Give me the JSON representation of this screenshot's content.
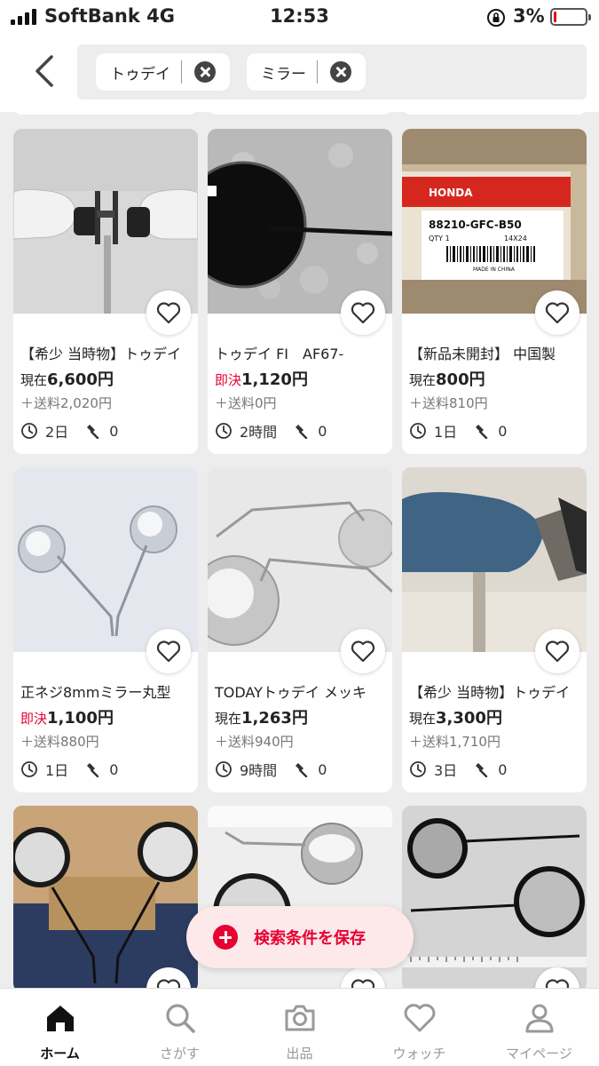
{
  "status_bar": {
    "carrier": "SoftBank",
    "network": "4G",
    "time": "12:53",
    "battery": "3%"
  },
  "search": {
    "chips": [
      "トゥデイ",
      "ミラー"
    ]
  },
  "items": [
    {
      "title": "【希少 当時物】トゥデイ",
      "price_label": "現在",
      "price": "6,600円",
      "shipping": "＋送料2,020円",
      "time": "2日",
      "bids": "0"
    },
    {
      "title": "トゥデイ FI　AF67-",
      "price_label": "",
      "sokketsu": "即決",
      "price": "1,120円",
      "shipping": "＋送料0円",
      "time": "2時間",
      "bids": "0"
    },
    {
      "title": "【新品未開封】 中国製",
      "price_label": "現在",
      "price": "800円",
      "shipping": "＋送料810円",
      "time": "1日",
      "bids": "0"
    },
    {
      "title": "正ネジ8mmミラー丸型",
      "price_label": "",
      "sokketsu": "即決",
      "price": "1,100円",
      "shipping": "＋送料880円",
      "time": "1日",
      "bids": "0"
    },
    {
      "title": "TODAYトゥデイ メッキ",
      "price_label": "現在",
      "price": "1,263円",
      "shipping": "＋送料940円",
      "time": "9時間",
      "bids": "0"
    },
    {
      "title": "【希少 当時物】トゥデイ",
      "price_label": "現在",
      "price": "3,300円",
      "shipping": "＋送料1,710円",
      "time": "3日",
      "bids": "0"
    }
  ],
  "product_image_text": {
    "honda_brand": "HONDA",
    "part_number": "88210-GFC-B50",
    "qty": "QTY  1",
    "size": "14X24",
    "origin": "MADE IN CHINA"
  },
  "save_button": {
    "label": "検索条件を保存"
  },
  "tabbar": [
    "ホーム",
    "さがす",
    "出品",
    "ウォッチ",
    "マイページ"
  ],
  "colors": {
    "accent": "#e60033",
    "background": "#ededed"
  }
}
